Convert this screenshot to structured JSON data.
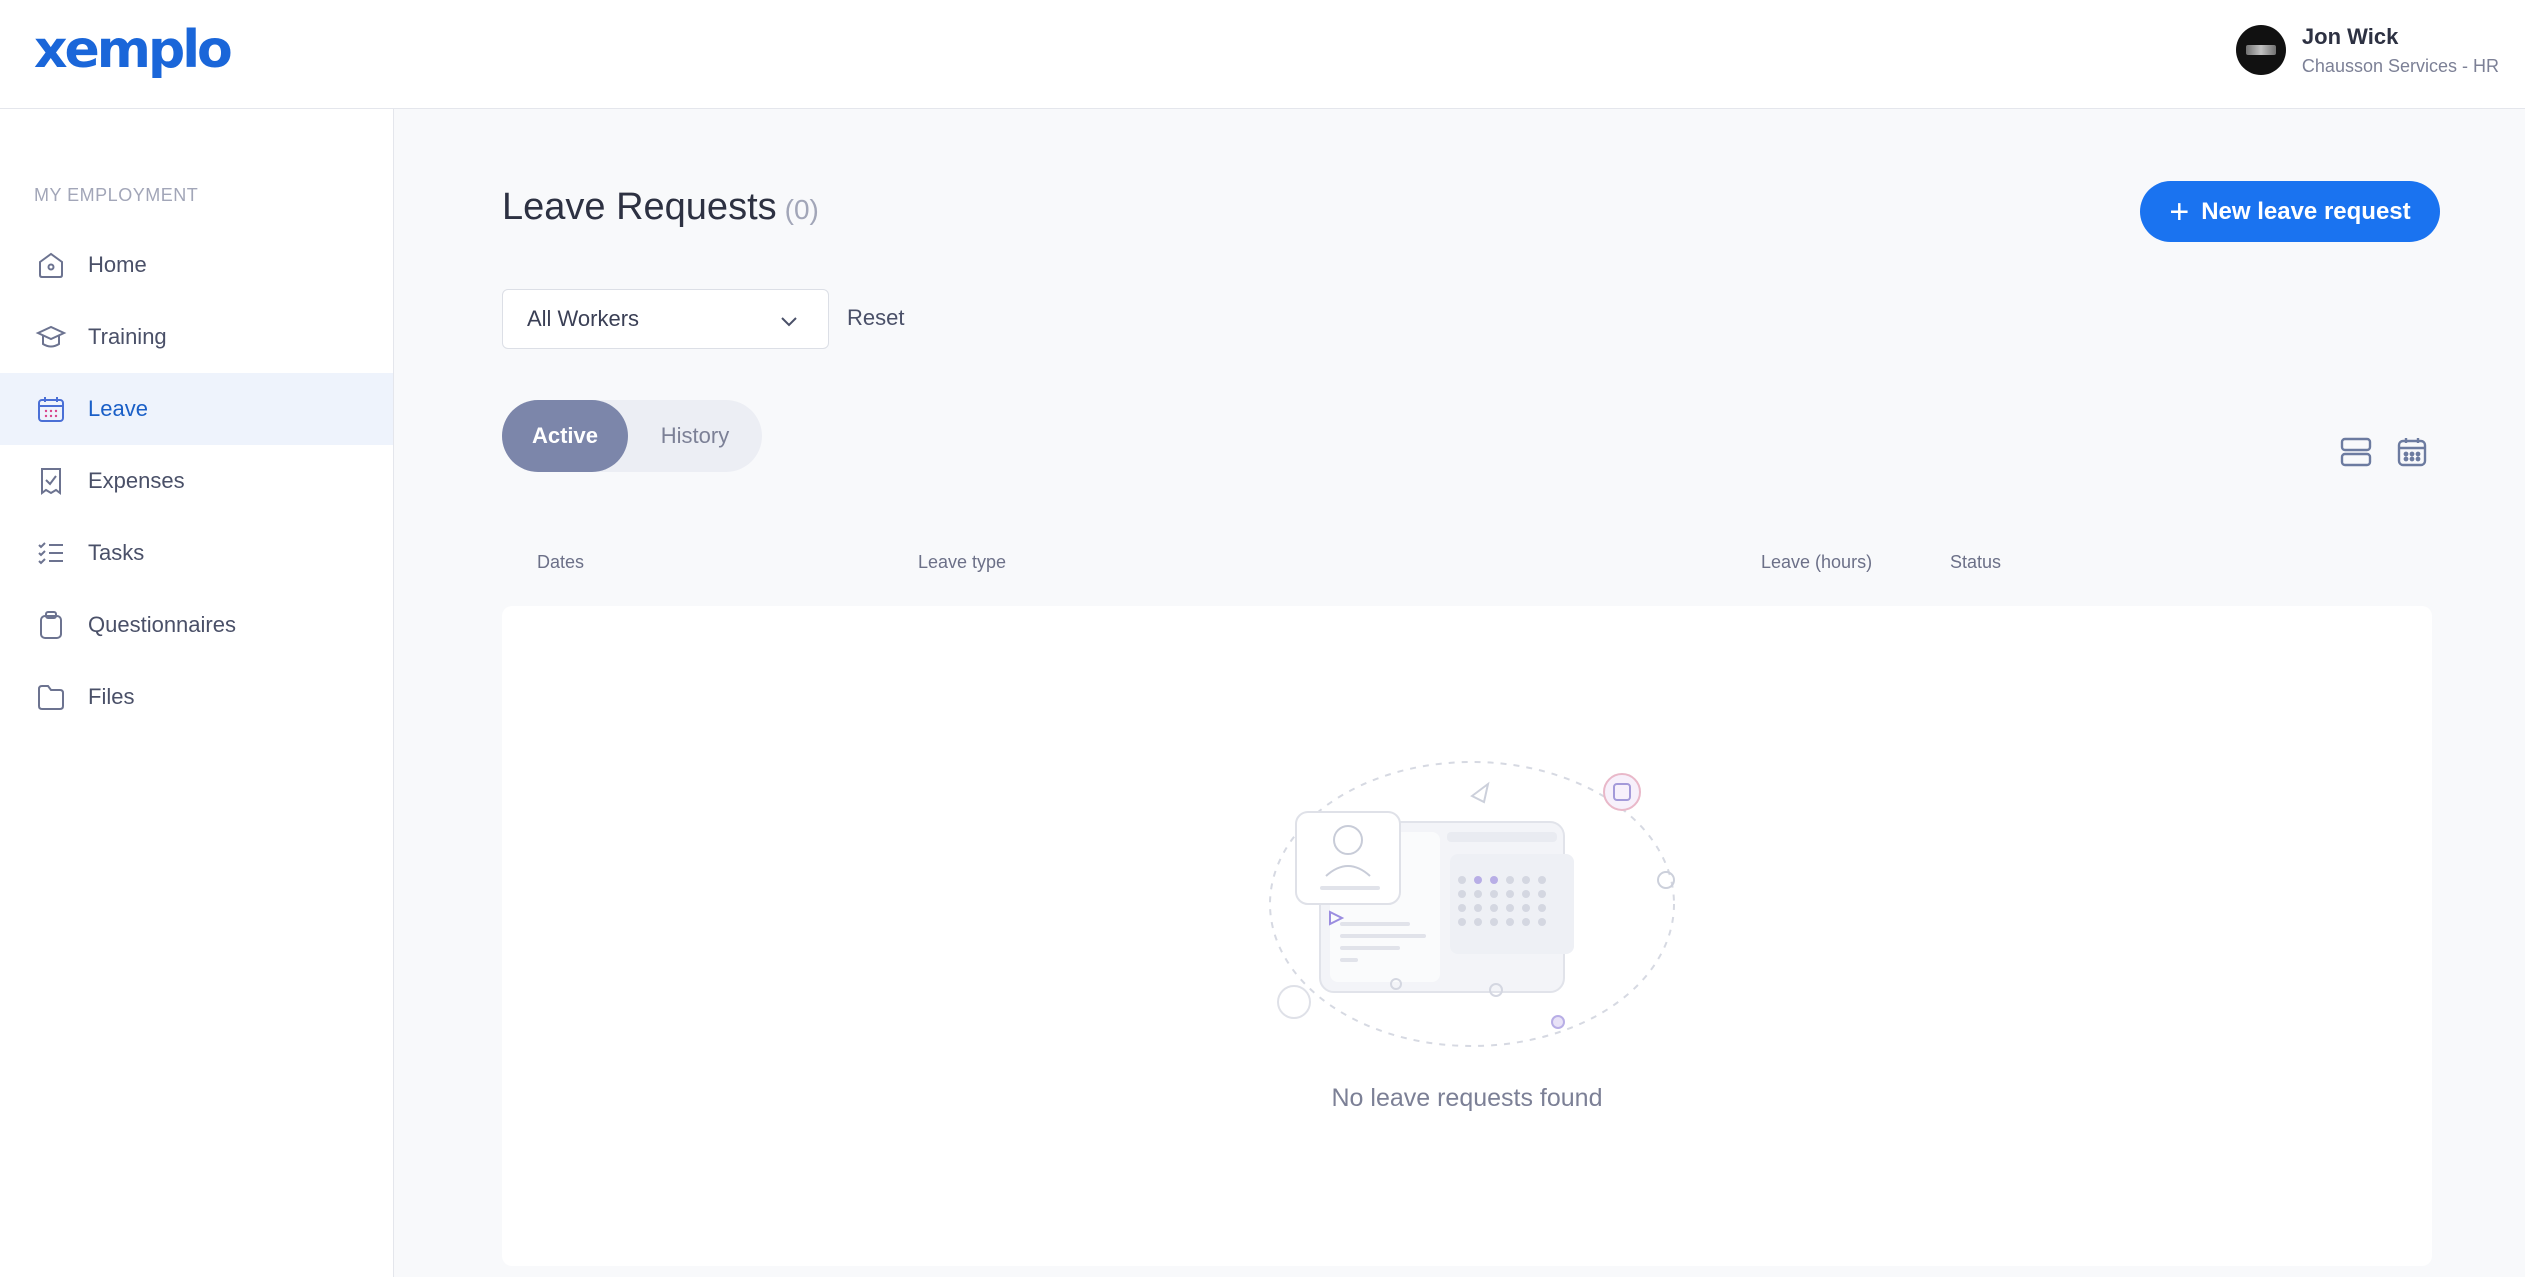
{
  "header": {
    "logo": "xemplo",
    "user_name": "Jon Wick",
    "user_org": "Chausson Services - HR"
  },
  "sidebar": {
    "heading": "MY EMPLOYMENT",
    "items": [
      {
        "label": "Home",
        "icon": "home-icon",
        "active": false
      },
      {
        "label": "Training",
        "icon": "graduation-cap-icon",
        "active": false
      },
      {
        "label": "Leave",
        "icon": "calendar-icon",
        "active": true
      },
      {
        "label": "Expenses",
        "icon": "receipt-icon",
        "active": false
      },
      {
        "label": "Tasks",
        "icon": "checklist-icon",
        "active": false
      },
      {
        "label": "Questionnaires",
        "icon": "clipboard-icon",
        "active": false
      },
      {
        "label": "Files",
        "icon": "folder-icon",
        "active": false
      }
    ]
  },
  "main": {
    "title": "Leave Requests",
    "count": "(0)",
    "new_button": "New leave request",
    "filter_value": "All Workers",
    "reset_label": "Reset",
    "tabs": {
      "active": "Active",
      "history": "History"
    },
    "columns": [
      "Dates",
      "Leave type",
      "Leave (hours)",
      "Status"
    ],
    "empty_message": "No leave requests found"
  },
  "colors": {
    "brand": "#1a66d9",
    "primary_button": "#1a73f0",
    "active_tab": "#7c86aa",
    "active_nav_bg": "#eef3fc"
  }
}
